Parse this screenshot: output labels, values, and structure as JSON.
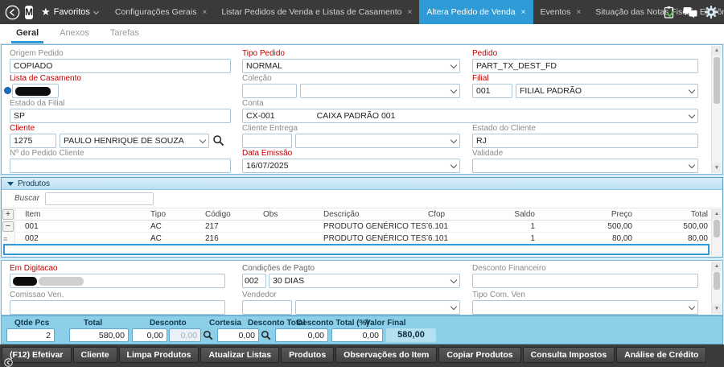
{
  "colors": {
    "accent_blue": "#2e9bd6",
    "red_label": "#c00000",
    "summary_bg": "#8ccfe9",
    "topbar_bg": "#3a3a3a",
    "selected_row_border": "#2f9ad8",
    "check_green": "#57c24e"
  },
  "topbar": {
    "logo_letter": "M",
    "favorites": {
      "label": "Favoritos"
    },
    "tabs": [
      {
        "label": "Configurações Gerais",
        "active": false
      },
      {
        "label": "Listar Pedidos de Venda e Listas de Casamento",
        "active": false
      },
      {
        "label": "Altera Pedido de Venda",
        "active": true
      },
      {
        "label": "Eventos",
        "active": false
      },
      {
        "label": "Situação das Notas Fiscais Eletrônicas",
        "active": false
      }
    ],
    "icons": [
      "task-check-icon",
      "chat-icon",
      "gear-icon"
    ]
  },
  "page_tabs": [
    {
      "label": "Geral",
      "active": true
    },
    {
      "label": "Anexos",
      "active": false
    },
    {
      "label": "Tarefas",
      "active": false
    }
  ],
  "form": {
    "origem_pedido": {
      "label": "Origem Pedido",
      "value": "COPIADO"
    },
    "tipo_pedido": {
      "label": "Tipo Pedido",
      "value": "NORMAL"
    },
    "pedido": {
      "label": "Pedido",
      "value": "PART_TX_DEST_FD"
    },
    "lista_casamento": {
      "label": "Lista de Casamento",
      "value": ""
    },
    "colecao": {
      "label": "Coleção",
      "code": "",
      "value": ""
    },
    "filial": {
      "label": "Filial",
      "code": "001",
      "value": "FILIAL PADRÃO"
    },
    "estado_filial": {
      "label": "Estado da Filial",
      "value": "SP"
    },
    "conta": {
      "label": "Conta",
      "code": "CX-001",
      "name": "CAIXA PADRÃO 001"
    },
    "cliente": {
      "label": "Cliente",
      "code": "1275",
      "value": "PAULO HENRIQUE DE SOUZA"
    },
    "cliente_entrega": {
      "label": "Cliente Entrega",
      "code": "",
      "value": ""
    },
    "estado_cliente": {
      "label": "Estado do Cliente",
      "value": "RJ"
    },
    "num_pedido_cliente": {
      "label": "Nº do Pedido Cliente",
      "value": ""
    },
    "data_emissao": {
      "label": "Data Emissão",
      "value": "16/07/2025"
    },
    "validade": {
      "label": "Validade",
      "value": ""
    }
  },
  "products": {
    "section_title": "Produtos",
    "search_label": "Buscar",
    "add_button": "+",
    "remove_button": "−",
    "more_glyph": "≡",
    "columns": [
      "Item",
      "Tipo",
      "Código",
      "Obs",
      "Descrição",
      "Cfop",
      "Saldo",
      "Preço",
      "Total"
    ],
    "rows": [
      {
        "item": "001",
        "tipo": "AC",
        "codigo": "217",
        "obs": "",
        "descricao": "PRODUTO GENÉRICO TEST...",
        "cfop": "6.101",
        "saldo": "1",
        "preco": "500,00",
        "total": "500,00"
      },
      {
        "item": "002",
        "tipo": "AC",
        "codigo": "216",
        "obs": "",
        "descricao": "PRODUTO GENÉRICO TEST...",
        "cfop": "6.101",
        "saldo": "1",
        "preco": "80,00",
        "total": "80,00"
      }
    ]
  },
  "lower": {
    "em_digitacao": {
      "label": "Em Digitacao"
    },
    "condicoes_pagto": {
      "label": "Condições de Pagto",
      "code": "002",
      "value": "30 DIAS"
    },
    "desconto_financeiro": {
      "label": "Desconto Financeiro",
      "value": ""
    },
    "comissao_ven": {
      "label": "Comissao Ven.",
      "value": ""
    },
    "vendedor": {
      "label": "Vendedor",
      "code": "",
      "value": ""
    },
    "tipo_com_ven": {
      "label": "Tipo Com. Ven",
      "value": ""
    }
  },
  "summary": {
    "qtde_pcs": {
      "label": "Qtde Pcs",
      "value": "2"
    },
    "total": {
      "label": "Total",
      "value": "580,00"
    },
    "desconto": {
      "label": "Desconto",
      "value1": "0,00",
      "value2": "0,00"
    },
    "cortesia": {
      "label": "Cortesia",
      "value": "0,00"
    },
    "desconto_total": {
      "label": "Desconto Total",
      "value": "0,00"
    },
    "desconto_total_pct": {
      "label": "Desconto Total (%)",
      "value": "0,00"
    },
    "valor_final": {
      "label": "Valor Final",
      "value": "580,00"
    }
  },
  "footer": {
    "buttons": [
      "(F12) Efetivar",
      "Cliente",
      "Limpa Produtos",
      "Atualizar Listas",
      "Produtos",
      "Observações do Item",
      "Copiar Produtos",
      "Consulta Impostos",
      "Análise de Crédito"
    ]
  }
}
